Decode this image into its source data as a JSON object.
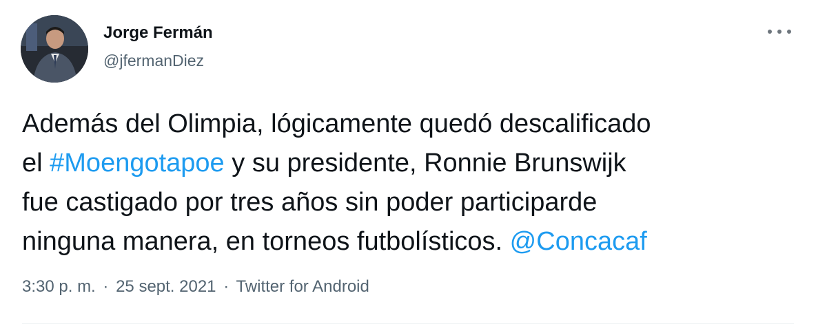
{
  "author": {
    "name": "Jorge Fermán",
    "handle": "@jfermanDiez",
    "avatar_icon": "profile-photo"
  },
  "more_icon": "more-horizontal-icon",
  "tweet": {
    "line1": "Además del Olimpia, lógicamente quedó descalificado",
    "line2_prefix": "el ",
    "hashtag": "#Moengotapoe",
    "line2_suffix": " y su presidente, Ronnie Brunswijk",
    "line3": "fue castigado por tres años sin poder participarde",
    "line4": "ninguna manera, en torneos futbolísticos. ",
    "mention": "@Concacaf"
  },
  "meta": {
    "time": "3:30 p. m.",
    "separator": "·",
    "date": "25 sept. 2021",
    "source": "Twitter for Android"
  },
  "colors": {
    "link": "#1d9bf0",
    "text": "#0f1419",
    "secondary": "#536471"
  }
}
